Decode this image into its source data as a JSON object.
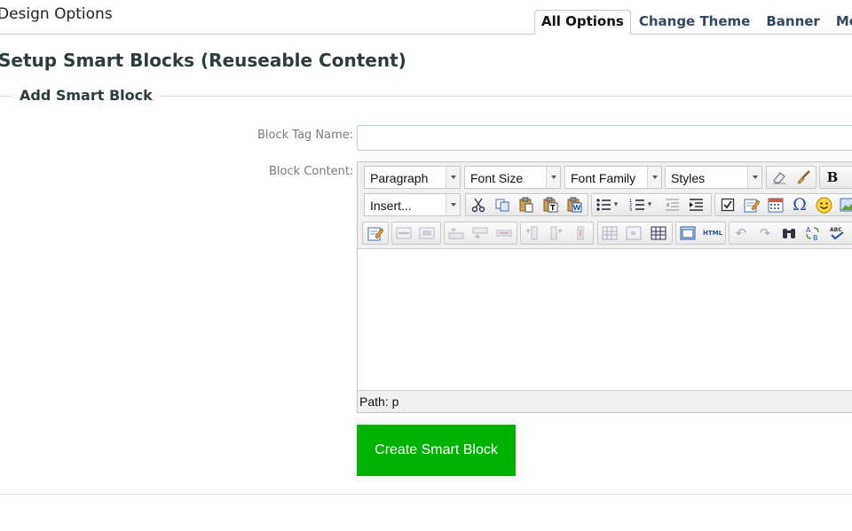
{
  "header": {
    "page_title": "Design Options",
    "tabs": [
      {
        "label": "All Options",
        "active": true
      },
      {
        "label": "Change Theme",
        "active": false
      },
      {
        "label": "Banner",
        "active": false
      },
      {
        "label": "Menu",
        "active": false
      }
    ]
  },
  "main": {
    "section_title": "Setup Smart Blocks (Reuseable Content)",
    "fieldset_legend": "Add Smart Block",
    "tag_name": {
      "label": "Block Tag Name:",
      "value": "",
      "placeholder": ""
    },
    "content": {
      "label": "Block Content:"
    },
    "editor": {
      "dropdowns": {
        "format": "Paragraph",
        "font_size": "Font Size",
        "font_family": "Font Family",
        "styles": "Styles",
        "insert": "Insert..."
      },
      "bold_glyph": "B",
      "html_label": "HTML",
      "special_char_glyph": "Ω",
      "path_text": "Path: p"
    },
    "submit_label": "Create Smart Block"
  },
  "colors": {
    "submit_bg": "#00b300",
    "heading": "#2d3c3c",
    "tab_text": "#34495e",
    "input_border": "#b7cde0"
  }
}
